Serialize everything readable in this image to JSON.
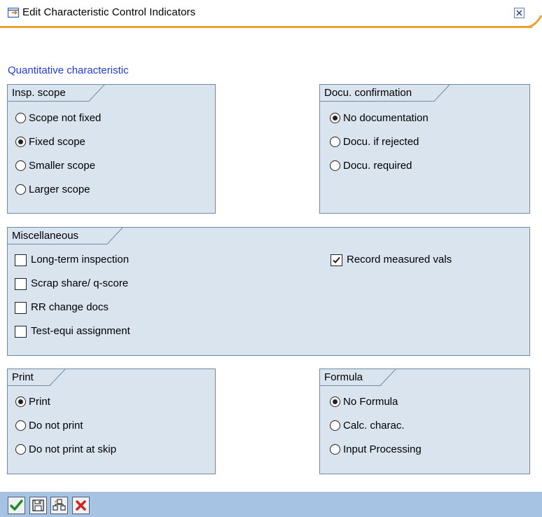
{
  "window": {
    "title": "Edit Characteristic Control Indicators"
  },
  "section_label": "Quantitative characteristic",
  "insp_scope": {
    "title": "Insp. scope",
    "options": [
      {
        "label": "Scope not fixed",
        "selected": false
      },
      {
        "label": "Fixed scope",
        "selected": true
      },
      {
        "label": "Smaller scope",
        "selected": false
      },
      {
        "label": "Larger scope",
        "selected": false
      }
    ]
  },
  "docu_confirmation": {
    "title": "Docu. confirmation",
    "options": [
      {
        "label": "No documentation",
        "selected": true
      },
      {
        "label": "Docu. if rejected",
        "selected": false
      },
      {
        "label": "Docu. required",
        "selected": false
      }
    ]
  },
  "miscellaneous": {
    "title": "Miscellaneous",
    "checkboxes": [
      {
        "label": "Long-term inspection",
        "checked": false
      },
      {
        "label": "Scrap share/ q-score",
        "checked": false
      },
      {
        "label": "RR change docs",
        "checked": false
      },
      {
        "label": "Test-equi assignment",
        "checked": false
      },
      {
        "label": "Record measured vals",
        "checked": true
      }
    ]
  },
  "print": {
    "title": "Print",
    "options": [
      {
        "label": "Print",
        "selected": true
      },
      {
        "label": "Do not print",
        "selected": false
      },
      {
        "label": "Do not print at skip",
        "selected": false
      }
    ]
  },
  "formula": {
    "title": "Formula",
    "options": [
      {
        "label": "No Formula",
        "selected": true
      },
      {
        "label": "Calc. charac.",
        "selected": false
      },
      {
        "label": "Input Processing",
        "selected": false
      }
    ]
  },
  "toolbar": {
    "buttons": [
      {
        "icon": "checkmark-icon"
      },
      {
        "icon": "save-icon"
      },
      {
        "icon": "hierarchy-icon"
      },
      {
        "icon": "cancel-icon"
      }
    ]
  },
  "colors": {
    "panel_bg": "#d9e4ee",
    "panel_border": "#6f8aa3",
    "accent_orange": "#f0a030",
    "toolbar_bg": "#a7c3e4",
    "link_blue": "#1f3ddc"
  }
}
